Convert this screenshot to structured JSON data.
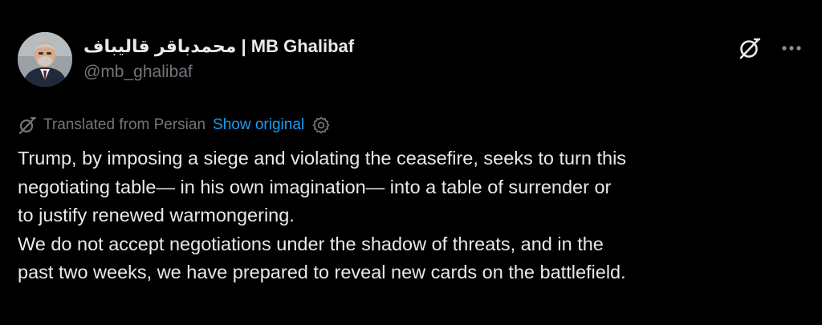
{
  "author": {
    "display_name": "محمدباقر قالیباف | MB Ghalibaf",
    "handle": "@mb_ghalibaf",
    "avatar_icon": "user-avatar-photo"
  },
  "actions": {
    "grok_icon": "grok-icon",
    "more_icon": "more-icon"
  },
  "translation": {
    "label": "Translated from Persian",
    "show_original": "Show original",
    "translate_icon": "translate-icon",
    "settings_icon": "gear-icon"
  },
  "tweet": {
    "lines": [
      "Trump, by imposing a siege and violating the ceasefire, seeks to turn this",
      "negotiating table— in his own imagination— into a table of surrender or",
      "to justify renewed warmongering.",
      "We do not accept negotiations under the shadow of threats, and in the",
      "past two weeks, we have prepared to reveal new cards on the battlefield."
    ]
  },
  "colors": {
    "background": "#000000",
    "text_primary": "#e7e9ea",
    "text_secondary": "#71767b",
    "link": "#1d9bf0"
  }
}
